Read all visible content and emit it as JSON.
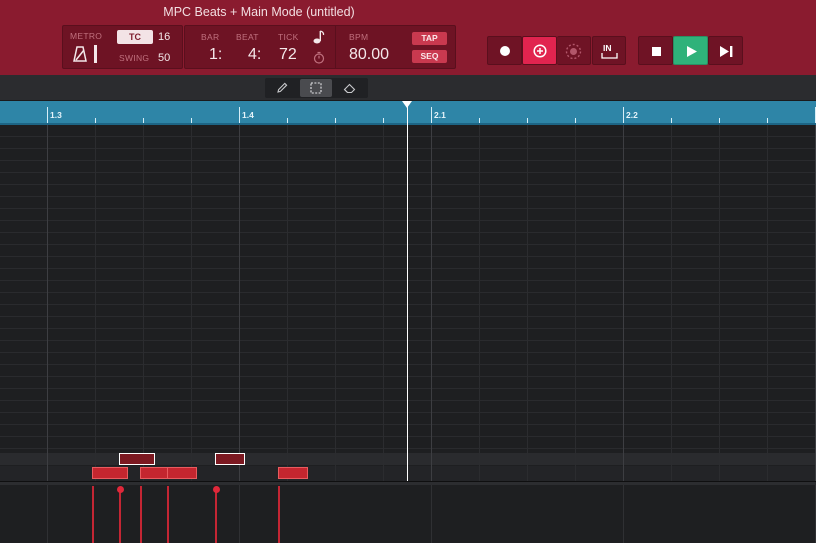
{
  "window": {
    "title": "MPC Beats + Main Mode (untitled)"
  },
  "transport": {
    "metro_label": "METRO",
    "tc_label": "TC",
    "tc_value": "16",
    "swing_label": "SWING",
    "swing_value": "50",
    "bar_label": "BAR",
    "beat_label": "BEAT",
    "tick_label": "TICK",
    "bar_value": "1:",
    "beat_value": "4:",
    "tick_value": "72",
    "bpm_label": "BPM",
    "bpm_value": "80.00",
    "tap_label": "TAP",
    "seq_label": "SEQ",
    "in_label": "IN"
  },
  "ruler": {
    "labels": [
      "1.3",
      "1.4",
      "2.1",
      "2.2"
    ]
  },
  "notes": [
    {
      "row": "lower",
      "start": 0.9375,
      "length": 0.1875,
      "selected": false
    },
    {
      "row": "upper",
      "start": 1.5,
      "length": 0.1875,
      "selected": true
    },
    {
      "row": "lower",
      "start": 1.9375,
      "length": 0.1875,
      "selected": false
    },
    {
      "row": "lower",
      "start": 2.5,
      "length": 0.1563,
      "selected": false
    },
    {
      "row": "upper",
      "start": 3.5,
      "length": 0.1563,
      "selected": true
    },
    {
      "row": "lower",
      "start": 4.8125,
      "length": 0.1563,
      "selected": false
    }
  ],
  "playhead_beat": 1.875,
  "colors": {
    "header_bg": "#8a1b2f",
    "note_fill": "#c4262f",
    "note_selected": "#7c1921",
    "ruler": "#2e85a7",
    "play_active": "#2fb27a",
    "accent_pink": "#e1244f"
  }
}
